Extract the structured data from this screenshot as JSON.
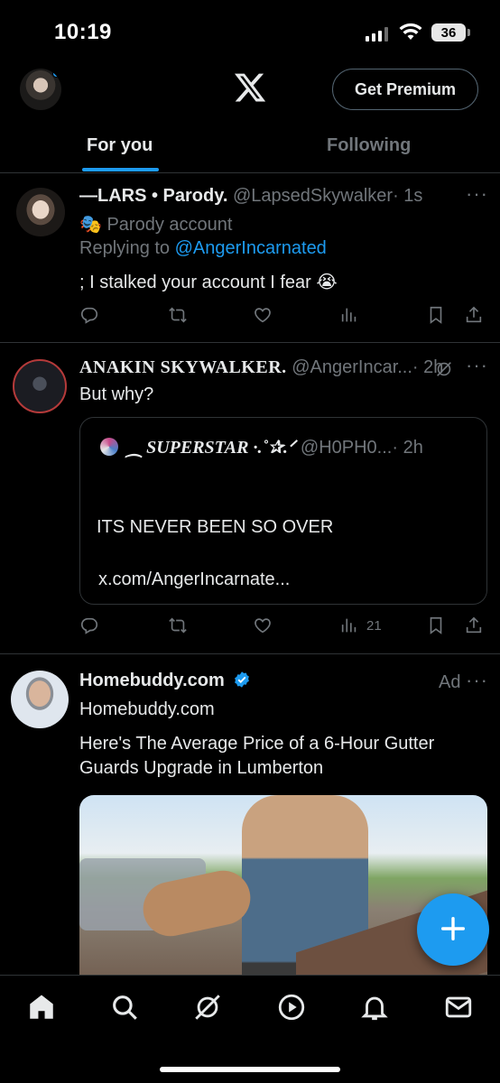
{
  "status_bar": {
    "time": "10:19",
    "battery": "36"
  },
  "header": {
    "premium_label": "Get Premium",
    "logo_icon": "x-logo-icon"
  },
  "tabs": [
    {
      "label": "For you",
      "active": true
    },
    {
      "label": "Following",
      "active": false
    }
  ],
  "posts": [
    {
      "name": "—LARS • Parody.",
      "handle": "@LapsedSkywalker",
      "time": "· 1s",
      "badge": "Parody account",
      "replying_prefix": "Replying to ",
      "replying_to": "@AngerIncarnated",
      "text": "; I stalked your account I fear 😭"
    },
    {
      "name": "ANAKIN SKYWALKER.",
      "handle": "@AngerIncar...",
      "time": "· 2h",
      "text": "But why?",
      "views": "21",
      "quote": {
        "name": "⁔ SUPERSTAR ·.˚✰.ᐟ",
        "handle": "@H0PH0...",
        "time": "· 2h",
        "text": "ITS NEVER BEEN SO OVER",
        "link": "x.com/AngerIncarnate..."
      }
    },
    {
      "name": "Homebuddy.com",
      "subname": "Homebuddy.com",
      "ad_label": "Ad",
      "text_line1": "Here's The Average Price of a 6-Hour Gutter",
      "text_line2": "Guards Upgrade in Lumberton"
    }
  ],
  "colors": {
    "accent": "#1d9bf0",
    "muted": "#71767b",
    "text": "#e7e9ea",
    "divider": "#2f3336",
    "background": "#000000"
  }
}
